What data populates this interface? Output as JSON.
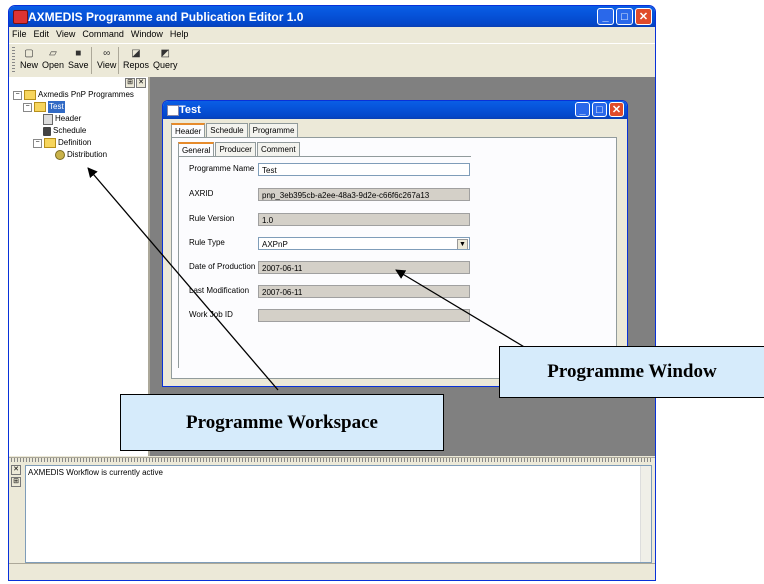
{
  "app": {
    "title": "AXMEDIS Programme and Publication Editor 1.0",
    "menu": [
      "File",
      "Edit",
      "View",
      "Command",
      "Window",
      "Help"
    ],
    "toolbar": [
      {
        "label": "New",
        "icon": "new-file-icon"
      },
      {
        "label": "Open",
        "icon": "open-folder-icon"
      },
      {
        "label": "Save",
        "icon": "save-disk-icon"
      },
      {
        "label": "View",
        "icon": "binoculars-icon"
      },
      {
        "label": "Repos",
        "icon": "repository-icon"
      },
      {
        "label": "Query",
        "icon": "query-icon"
      }
    ]
  },
  "workspace": {
    "tree": [
      {
        "label": "Axmedis PnP Programmes",
        "level": 0,
        "icon": "folder",
        "expander": "-"
      },
      {
        "label": "Test",
        "level": 1,
        "icon": "folder",
        "expander": "-",
        "selected": true
      },
      {
        "label": "Header",
        "level": 2,
        "icon": "page"
      },
      {
        "label": "Schedule",
        "level": 2,
        "icon": "schedule"
      },
      {
        "label": "Definition",
        "level": 2,
        "icon": "folder",
        "expander": "-"
      },
      {
        "label": "Distribution",
        "level": 3,
        "icon": "gear"
      }
    ]
  },
  "child_window": {
    "title": "Test",
    "tabs": [
      "Header",
      "Schedule",
      "Programme"
    ],
    "subtabs": [
      "General",
      "Producer",
      "Comment"
    ],
    "fields": [
      {
        "label": "Programme Name",
        "value": "Test",
        "kind": "rw"
      },
      {
        "label": "AXRID",
        "value": "pnp_3eb395cb-a2ee-48a3-9d2e-c66f6c267a13",
        "kind": "ro"
      },
      {
        "label": "Rule Version",
        "value": "1.0",
        "kind": "ro"
      },
      {
        "label": "Rule Type",
        "value": "AXPnP",
        "kind": "select"
      },
      {
        "label": "Date of Production",
        "value": "2007-06-11",
        "kind": "ro"
      },
      {
        "label": "Last Modification",
        "value": "2007-06-11",
        "kind": "ro"
      },
      {
        "label": "Work Job ID",
        "value": "",
        "kind": "ro"
      }
    ]
  },
  "output": {
    "message": "AXMEDIS Workflow is currently active"
  },
  "callouts": {
    "programme_window": "Programme Window",
    "programme_workspace": "Programme Workspace"
  },
  "colors": {
    "titlebar": "#0a5ee5",
    "callout_fill": "#d6ebfb",
    "mdi_background": "#808080"
  }
}
